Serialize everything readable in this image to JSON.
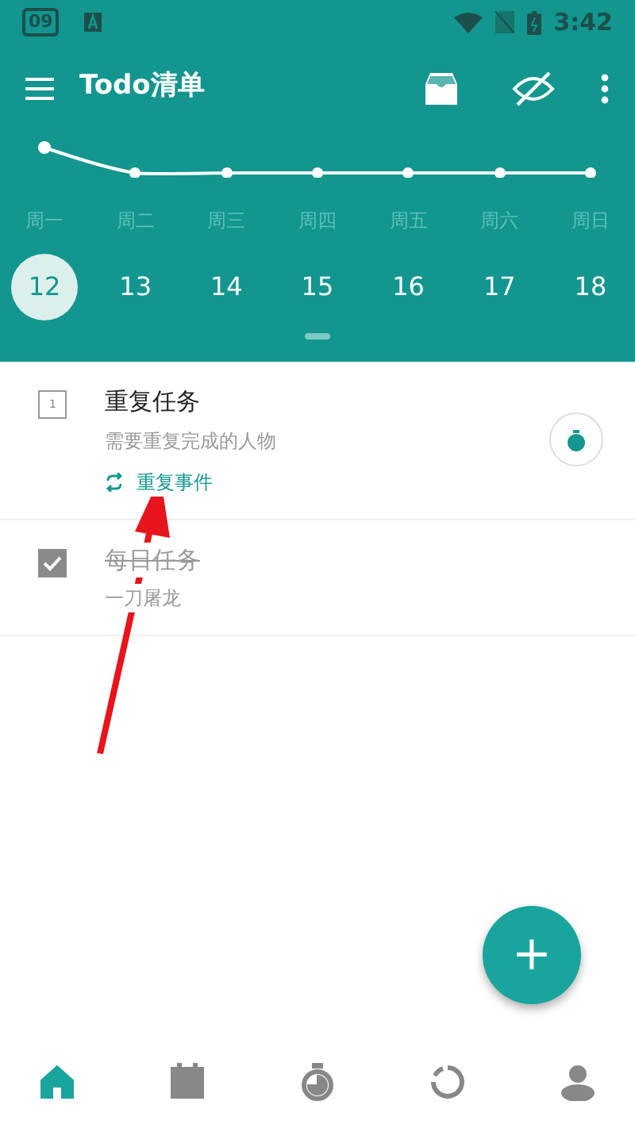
{
  "status_bar": {
    "badge": "09",
    "time": "3:42"
  },
  "toolbar": {
    "title": "Todo清单"
  },
  "week": [
    {
      "weekday": "周一",
      "date": "12",
      "selected": true
    },
    {
      "weekday": "周二",
      "date": "13",
      "selected": false
    },
    {
      "weekday": "周三",
      "date": "14",
      "selected": false
    },
    {
      "weekday": "周四",
      "date": "15",
      "selected": false
    },
    {
      "weekday": "周五",
      "date": "16",
      "selected": false
    },
    {
      "weekday": "周六",
      "date": "17",
      "selected": false
    },
    {
      "weekday": "周日",
      "date": "18",
      "selected": false
    }
  ],
  "tasks": [
    {
      "title": "重复任务",
      "note": "需要重复完成的人物",
      "count": "1",
      "tag": "重复事件",
      "checked": false
    },
    {
      "title": "每日任务",
      "note": "一刀屠龙",
      "checked": true
    }
  ],
  "fab": {
    "label": "+"
  },
  "bottom_nav": [
    {
      "kind": "home",
      "selected": true
    },
    {
      "kind": "calendar",
      "selected": false
    },
    {
      "kind": "timer",
      "selected": false
    },
    {
      "kind": "progress",
      "selected": false
    },
    {
      "kind": "profile",
      "selected": false
    }
  ]
}
